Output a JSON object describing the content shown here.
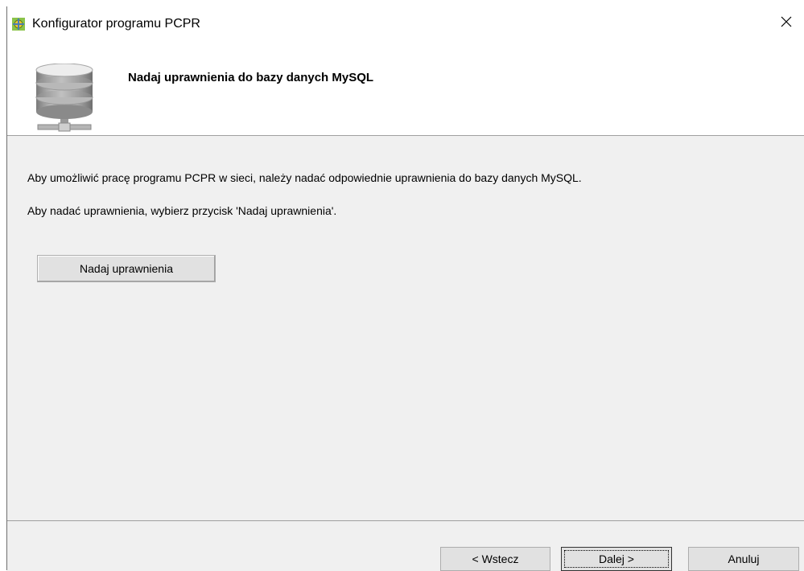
{
  "window": {
    "title": "Konfigurator programu PCPR",
    "close_symbol": "×"
  },
  "header": {
    "title": "Nadaj uprawnienia do bazy danych MySQL",
    "icon": "database-icon"
  },
  "content": {
    "message_1": "Aby umożliwić pracę programu PCPR w sieci, należy nadać odpowiednie uprawnienia do bazy danych MySQL.",
    "message_2": "Aby nadać uprawnienia, wybierz przycisk 'Nadaj uprawnienia'.",
    "grant_button_label": "Nadaj uprawnienia"
  },
  "footer": {
    "back_label": "< Wstecz",
    "next_label": "Dalej >",
    "cancel_label": "Anuluj"
  }
}
